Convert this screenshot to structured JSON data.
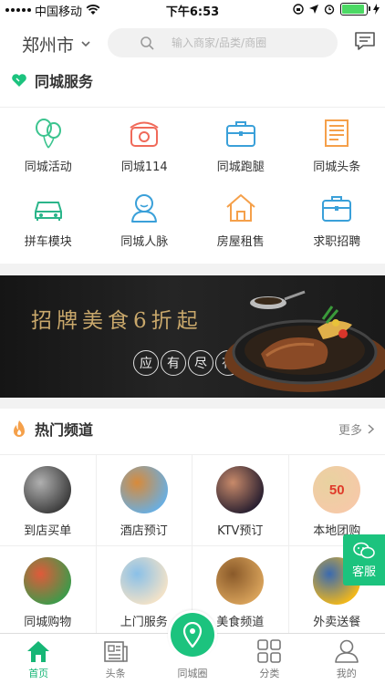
{
  "status_bar": {
    "carrier": "中国移动",
    "time": "下午6:53",
    "battery_level": 0.92
  },
  "header": {
    "city": "郑州市",
    "search_placeholder": "输入商家/品类/商圈"
  },
  "services": {
    "title": "同城服务",
    "items": [
      {
        "label": "同城活动",
        "icon": "balloons-icon",
        "color": "#3cc48f"
      },
      {
        "label": "同城114",
        "icon": "telephone-icon",
        "color": "#f06a5a"
      },
      {
        "label": "同城跑腿",
        "icon": "briefcase-icon",
        "color": "#3aa0d9"
      },
      {
        "label": "同城头条",
        "icon": "newspaper-icon",
        "color": "#f5a04a"
      },
      {
        "label": "拼车模块",
        "icon": "car-icon",
        "color": "#2bb58a"
      },
      {
        "label": "同城人脉",
        "icon": "person-icon",
        "color": "#3aa0d9"
      },
      {
        "label": "房屋租售",
        "icon": "house-icon",
        "color": "#f5a04a"
      },
      {
        "label": "求职招聘",
        "icon": "briefcase-icon",
        "color": "#3aa0d9"
      }
    ]
  },
  "banner": {
    "headline": "招牌美食6折起",
    "tag": [
      "应",
      "有",
      "尽",
      "有"
    ]
  },
  "channels": {
    "title": "热门频道",
    "more": "更多",
    "items": [
      {
        "label": "到店买单",
        "icon": "payment-photo",
        "c1": "#3d3d3d",
        "c2": "#b0b0b0"
      },
      {
        "label": "酒店预订",
        "icon": "hotel-photo",
        "c1": "#6aaee0",
        "c2": "#d88a3a"
      },
      {
        "label": "KTV预订",
        "icon": "singer-photo",
        "c1": "#2a2030",
        "c2": "#c88a6a"
      },
      {
        "label": "本地团购",
        "icon": "sale-tag-photo",
        "c1": "#f6c9a8",
        "c2": "#e8d2a0",
        "badge": "50"
      },
      {
        "label": "同城购物",
        "icon": "groceries-photo",
        "c1": "#3e9a4a",
        "c2": "#e05a3a"
      },
      {
        "label": "上门服务",
        "icon": "cleaning-photo",
        "c1": "#f2e2c8",
        "c2": "#8ac0e8"
      },
      {
        "label": "美食频道",
        "icon": "food-photo",
        "c1": "#d8a25a",
        "c2": "#8a5a2a"
      },
      {
        "label": "外卖送餐",
        "icon": "delivery-photo",
        "c1": "#f2b81a",
        "c2": "#3a6ab0"
      }
    ]
  },
  "support_button": {
    "label": "客服"
  },
  "tabbar": {
    "items": [
      {
        "label": "首页",
        "icon": "home-icon",
        "active": true
      },
      {
        "label": "头条",
        "icon": "news-icon",
        "active": false
      },
      {
        "label": "同城圈",
        "icon": "location-pin-icon",
        "active": false
      },
      {
        "label": "分类",
        "icon": "grid-icon",
        "active": false
      },
      {
        "label": "我的",
        "icon": "user-icon",
        "active": false
      }
    ]
  }
}
